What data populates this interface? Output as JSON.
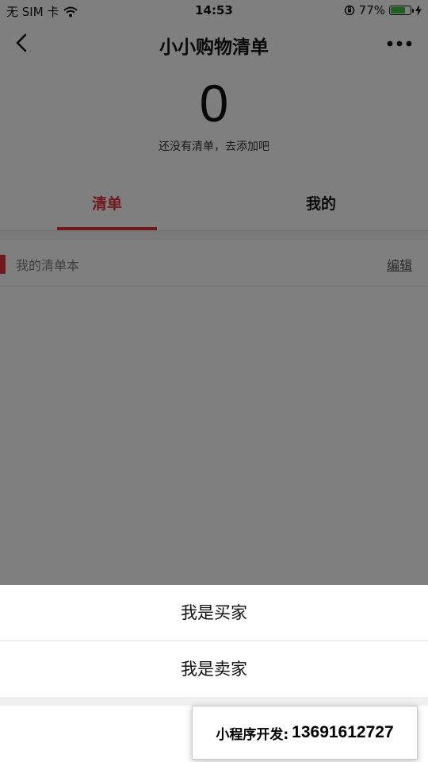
{
  "status_bar": {
    "carrier": "无 SIM 卡",
    "time": "14:53",
    "battery_percent": "77%",
    "battery_level": 0.77,
    "battery_color": "#39c43f"
  },
  "nav": {
    "title": "小小购物清单",
    "back_icon": "chevron-left-icon",
    "more_icon": "more-dots-icon"
  },
  "summary": {
    "count": "0",
    "hint": "还没有清单，去添加吧"
  },
  "tabs": [
    {
      "label": "清单",
      "active": true
    },
    {
      "label": "我的",
      "active": false
    }
  ],
  "notebook": {
    "title": "我的清单本",
    "edit_label": "编辑"
  },
  "action_sheet": {
    "options": [
      {
        "label": "我是买家"
      },
      {
        "label": "我是卖家"
      }
    ]
  },
  "watermark": {
    "label": "小程序开发:",
    "number": "13691612727"
  },
  "colors": {
    "accent": "#e0353f",
    "overlay": "rgba(0,0,0,0.5)"
  }
}
